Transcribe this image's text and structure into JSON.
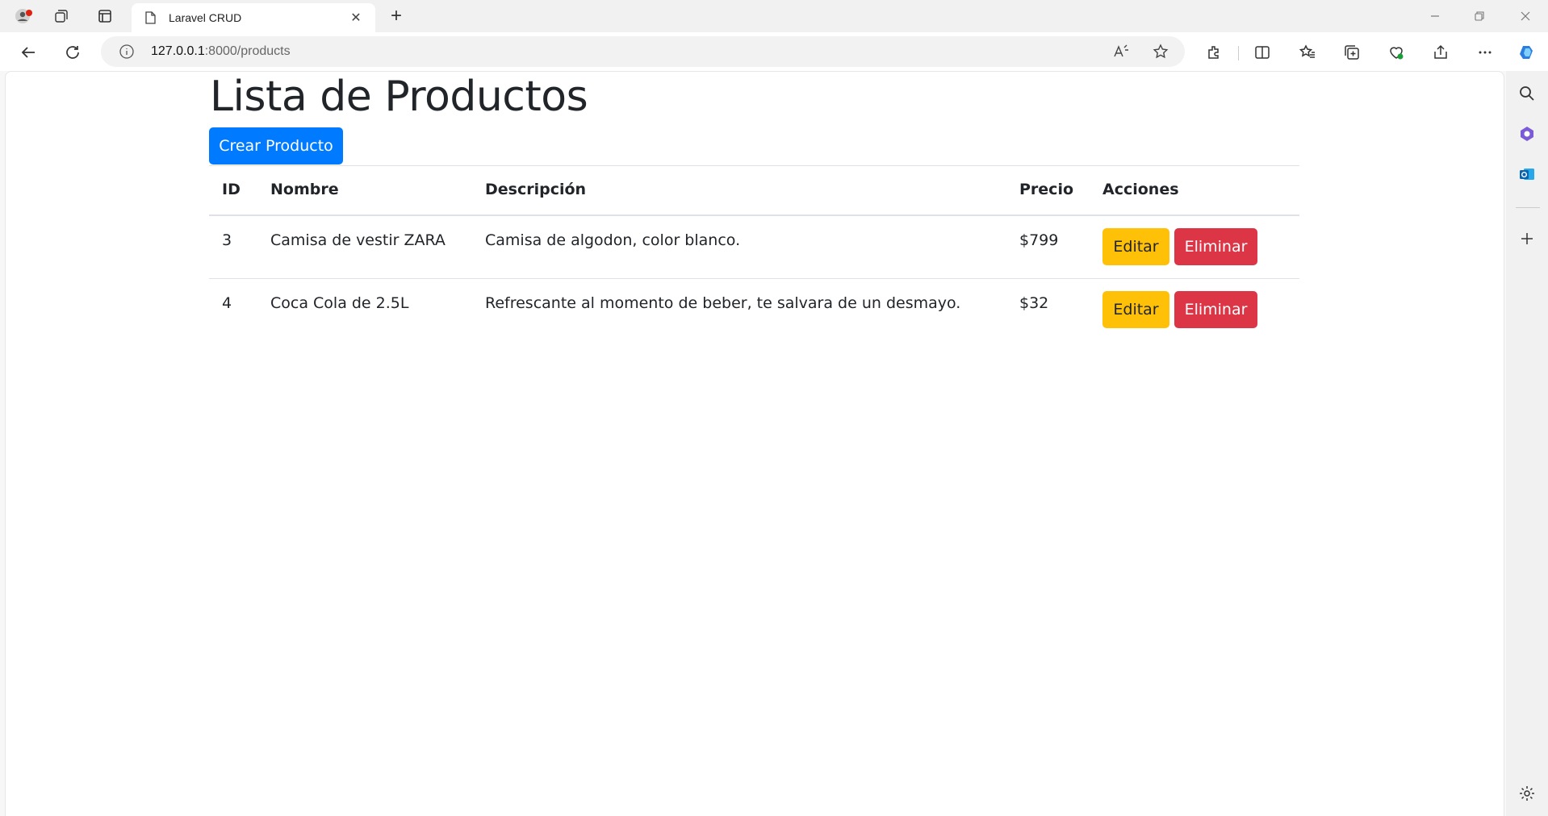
{
  "browser": {
    "tab_title": "Laravel CRUD",
    "url_host": "127.0.0.1",
    "url_path": ":8000/products"
  },
  "page": {
    "title": "Lista de Productos",
    "create_button": "Crear Producto",
    "table": {
      "headers": [
        "ID",
        "Nombre",
        "Descripción",
        "Precio",
        "Acciones"
      ],
      "rows": [
        {
          "id": "3",
          "nombre": "Camisa de vestir ZARA",
          "descripcion": "Camisa de algodon, color blanco.",
          "precio": "$799"
        },
        {
          "id": "4",
          "nombre": "Coca Cola de 2.5L",
          "descripcion": "Refrescante al momento de beber, te salvara de un desmayo.",
          "precio": "$32"
        }
      ],
      "edit_label": "Editar",
      "delete_label": "Eliminar"
    }
  },
  "colors": {
    "primary": "#007bff",
    "warning": "#ffc107",
    "danger": "#dc3545"
  }
}
